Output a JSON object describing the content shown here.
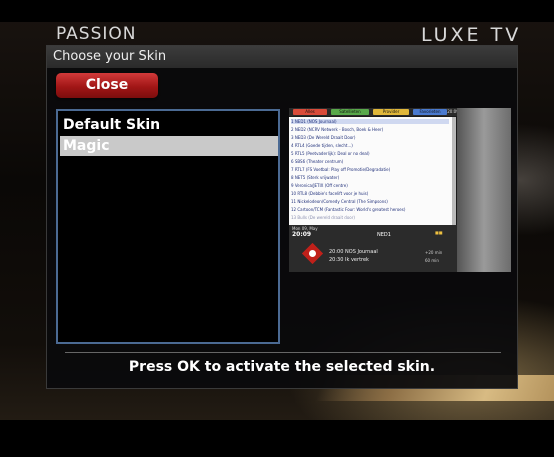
{
  "branding": {
    "left": "PASSION",
    "right": "LUXE TV"
  },
  "dialog": {
    "title": "Choose your Skin",
    "close_label": "Close",
    "skins": [
      {
        "label": "Default Skin",
        "selected": false
      },
      {
        "label": "Magic",
        "selected": true
      }
    ],
    "hint": "Press OK to activate the selected skin."
  },
  "preview": {
    "tabs": [
      {
        "label": "Alles",
        "color": "#d94b3a"
      },
      {
        "label": "Satellieten",
        "color": "#58a84a"
      },
      {
        "label": "Provider",
        "color": "#e0b73a"
      },
      {
        "label": "Favorieten",
        "color": "#4a7ad0"
      }
    ],
    "tab_extra": "20:09",
    "channels": [
      "1 NED1 (NOS Journaal)",
      "2 NED2 (NCRV Netwerk - Bosch, Boek & Heer)",
      "3 NED3 (De Wereld Draait Door)",
      "4 RTL4 (Goede tijden, slecht...)",
      "5 RTL5 (Peetvaderlijk): Deal or no deal)",
      "6 SBS6 (Theater centrum)",
      "7 RTL7 (FS Voetbal: Play off Promotie/Degradatie)",
      "8 NET5 (Sterk vrijwater)",
      "9 Veronica/JETIX (Off centre)",
      "10 RTL8 (Debbie's facelift voor je huis)",
      "11 Nickelodeon/Comedy Central (The Simpsons)",
      "12 Cartoon/TCM (Fantastic Four: World's greatest heroes)",
      "13 Bulls (De wereld draait door)"
    ],
    "date": "Mon 09, May",
    "time": "20:09",
    "channel_name": "NED1",
    "programs": [
      {
        "time": "20:00",
        "title": "NOS Journaal",
        "duration": "+20 min"
      },
      {
        "time": "20:30",
        "title": "Ik vertrek",
        "duration": "60 min"
      }
    ]
  }
}
